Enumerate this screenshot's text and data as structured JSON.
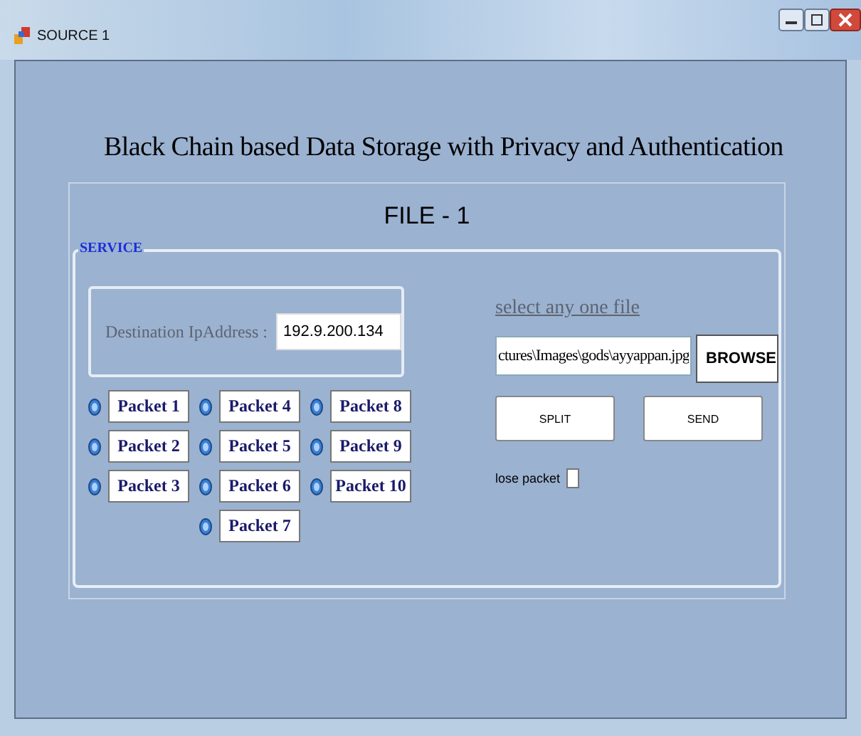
{
  "window": {
    "title": "SOURCE 1"
  },
  "heading": "Black Chain based Data Storage with Privacy and Authentication",
  "panel": {
    "title": "FILE - 1"
  },
  "service": {
    "legend": "SERVICE",
    "destination": {
      "label": "Destination IpAddress :",
      "value": "192.9.200.134"
    },
    "packet_columns": [
      [
        {
          "label": "Packet 1",
          "selected": false
        },
        {
          "label": "Packet 2",
          "selected": false
        },
        {
          "label": "Packet 3",
          "selected": false
        }
      ],
      [
        {
          "label": "Packet 4",
          "selected": false
        },
        {
          "label": "Packet 5",
          "selected": false
        },
        {
          "label": "Packet 6",
          "selected": false
        },
        {
          "label": "Packet 7",
          "selected": false
        }
      ],
      [
        {
          "label": "Packet 8",
          "selected": false
        },
        {
          "label": "Packet 9",
          "selected": false
        },
        {
          "label": "Packet 10",
          "selected": false
        }
      ]
    ],
    "file_label": "select any one file",
    "file_path": "ctures\\Images\\gods\\ayyappan.jpg",
    "browse_button": "BROWSE",
    "split_button": "SPLIT",
    "send_button": "SEND",
    "lose_packet": {
      "label": "lose packet",
      "checked": false
    }
  }
}
